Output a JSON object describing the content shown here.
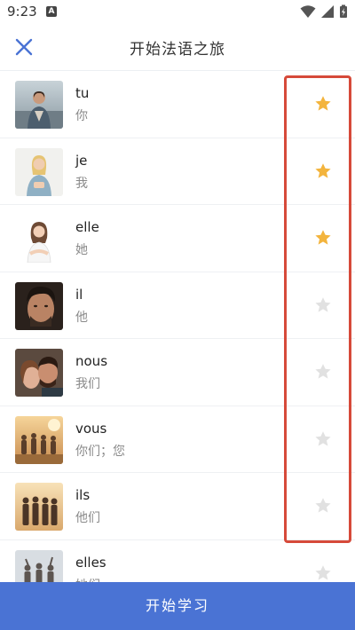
{
  "status_bar": {
    "time": "9:23",
    "notif_icon": "A"
  },
  "header": {
    "title": "开始法语之旅",
    "close_icon": "close-icon"
  },
  "colors": {
    "accent": "#4a73d4",
    "star_active": "#f3b43d",
    "star_inactive": "#e1e1e1",
    "highlight": "#d64a3a"
  },
  "words": [
    {
      "word": "tu",
      "meaning": "你",
      "starred": true
    },
    {
      "word": "je",
      "meaning": "我",
      "starred": true
    },
    {
      "word": "elle",
      "meaning": "她",
      "starred": true
    },
    {
      "word": "il",
      "meaning": "他",
      "starred": false
    },
    {
      "word": "nous",
      "meaning": "我们",
      "starred": false
    },
    {
      "word": "vous",
      "meaning": "你们；您",
      "starred": false
    },
    {
      "word": "ils",
      "meaning": "他们",
      "starred": false
    },
    {
      "word": "elles",
      "meaning": "她们",
      "starred": false
    }
  ],
  "footer": {
    "start_label": "开始学习"
  }
}
